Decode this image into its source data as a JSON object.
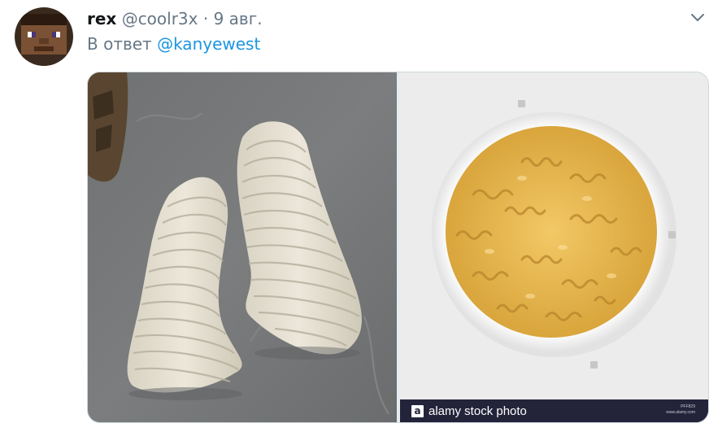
{
  "tweet": {
    "author_name": "rex",
    "author_handle": "@coolr3x",
    "separator": "·",
    "date": "9 авг.",
    "reply_prefix": "В ответ",
    "reply_mention": "@kanyewest"
  },
  "media": {
    "left_image": "slide-sneakers-photo",
    "right_image": "fusilli-pasta-bowl-photo",
    "stock_watermark": "alamy stock photo",
    "stock_logo_letter": "a",
    "stock_id": "PFF829",
    "stock_site": "www.alamy.com"
  },
  "icons": {
    "caret": "chevron-down-icon"
  },
  "colors": {
    "link": "#1b95e0",
    "secondary_text": "#657786",
    "primary_text": "#14171a",
    "stock_bar": "#23233a"
  }
}
